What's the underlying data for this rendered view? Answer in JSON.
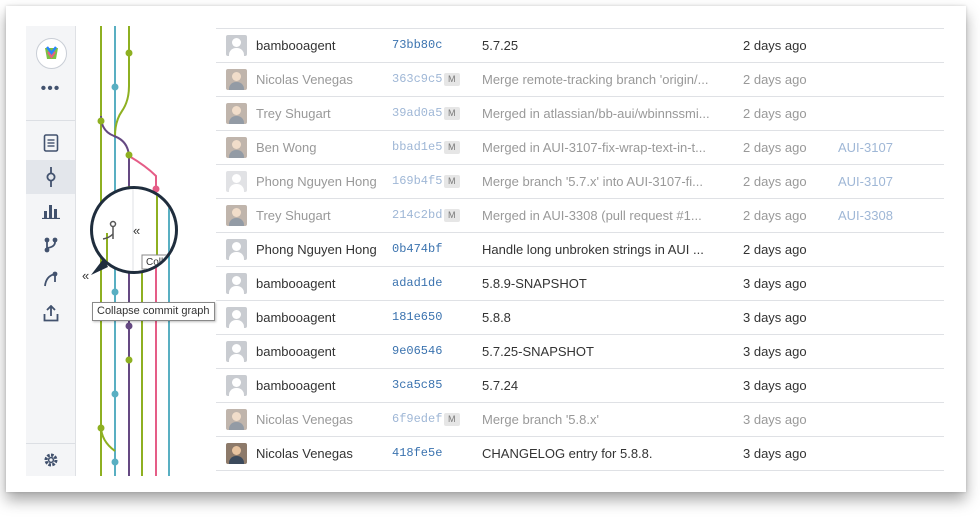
{
  "sidebar": {
    "more_label": "•••"
  },
  "graph": {
    "colors": {
      "green": "#8eb021",
      "teal": "#59afc2",
      "purple": "#654982",
      "pink": "#e55d87",
      "grey": "#9b9b9b"
    }
  },
  "magnifier": {
    "collapse_label": "«",
    "tooltip_fragment": "Coll"
  },
  "tooltip": {
    "arrow_label": "«",
    "text": "Collapse commit graph"
  },
  "commits": [
    {
      "author": "bambooagent",
      "hash": "73bb80c",
      "merge": "",
      "message": "5.7.25",
      "date": "2 days ago",
      "issue": "",
      "dim": false,
      "photo": false
    },
    {
      "author": "Nicolas Venegas",
      "hash": "363c9c5",
      "merge": "M",
      "message": "Merge remote-tracking branch 'origin/...",
      "date": "2 days ago",
      "issue": "",
      "dim": true,
      "photo": true
    },
    {
      "author": "Trey Shugart",
      "hash": "39ad0a5",
      "merge": "M",
      "message": "Merged in atlassian/bb-aui/wbinnssmi...",
      "date": "2 days ago",
      "issue": "",
      "dim": true,
      "photo": true
    },
    {
      "author": "Ben Wong",
      "hash": "bbad1e5",
      "merge": "M",
      "message": "Merged in AUI-3107-fix-wrap-text-in-t...",
      "date": "2 days ago",
      "issue": "AUI-3107",
      "dim": true,
      "photo": true
    },
    {
      "author": "Phong Nguyen Hong",
      "hash": "169b4f5",
      "merge": "M",
      "message": "Merge branch '5.7.x' into AUI-3107-fi...",
      "date": "2 days ago",
      "issue": "AUI-3107",
      "dim": true,
      "photo": false
    },
    {
      "author": "Trey Shugart",
      "hash": "214c2bd",
      "merge": "M",
      "message": "Merged in AUI-3308 (pull request #1...",
      "date": "2 days ago",
      "issue": "AUI-3308",
      "dim": true,
      "photo": true
    },
    {
      "author": "Phong Nguyen Hong",
      "hash": "0b474bf",
      "merge": "",
      "message": "Handle long unbroken strings in AUI ...",
      "date": "2 days ago",
      "issue": "",
      "dim": false,
      "photo": false
    },
    {
      "author": "bambooagent",
      "hash": "adad1de",
      "merge": "",
      "message": "5.8.9-SNAPSHOT",
      "date": "3 days ago",
      "issue": "",
      "dim": false,
      "photo": false
    },
    {
      "author": "bambooagent",
      "hash": "181e650",
      "merge": "",
      "message": "5.8.8",
      "date": "3 days ago",
      "issue": "",
      "dim": false,
      "photo": false
    },
    {
      "author": "bambooagent",
      "hash": "9e06546",
      "merge": "",
      "message": "5.7.25-SNAPSHOT",
      "date": "3 days ago",
      "issue": "",
      "dim": false,
      "photo": false
    },
    {
      "author": "bambooagent",
      "hash": "3ca5c85",
      "merge": "",
      "message": "5.7.24",
      "date": "3 days ago",
      "issue": "",
      "dim": false,
      "photo": false
    },
    {
      "author": "Nicolas Venegas",
      "hash": "6f9edef",
      "merge": "M",
      "message": "Merge branch '5.8.x'",
      "date": "3 days ago",
      "issue": "",
      "dim": true,
      "photo": true
    },
    {
      "author": "Nicolas Venegas",
      "hash": "418fe5e",
      "merge": "",
      "message": "CHANGELOG entry for 5.8.8.",
      "date": "3 days ago",
      "issue": "",
      "dim": false,
      "photo": true
    }
  ]
}
